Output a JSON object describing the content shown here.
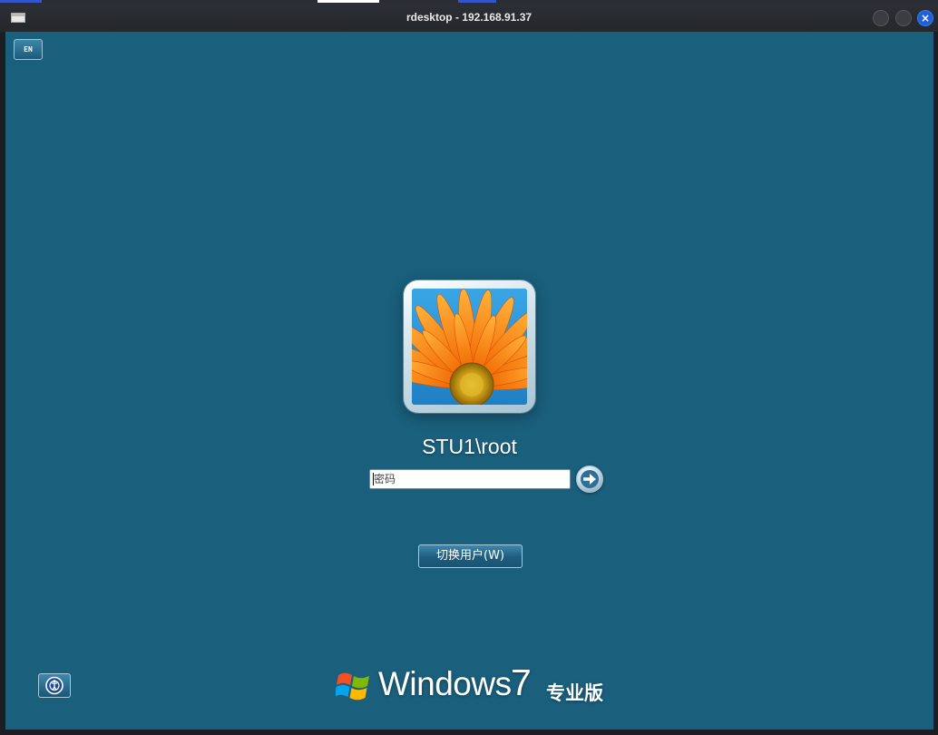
{
  "window": {
    "title": "rdesktop - 192.168.91.37",
    "close_glyph": "×",
    "app_icon": "window-icon",
    "controls": [
      "minimize-icon",
      "maximize-icon",
      "close-icon"
    ]
  },
  "login": {
    "language_indicator": "EN",
    "user_display": "STU1\\root",
    "password_placeholder": "密码",
    "password_value": "",
    "submit_icon": "arrow-right-icon",
    "switch_user_label": "切换用户(W)",
    "ease_of_access_icon": "ease-of-access-icon"
  },
  "branding": {
    "logo_icon": "windows-flag-icon",
    "word": "Windows",
    "version": "7",
    "edition": "专业版"
  },
  "colors": {
    "background": "#1a5f7c",
    "titlebar": "#24272c",
    "close_button": "#1f5fd9",
    "avatar_flower": "#f37a10"
  }
}
